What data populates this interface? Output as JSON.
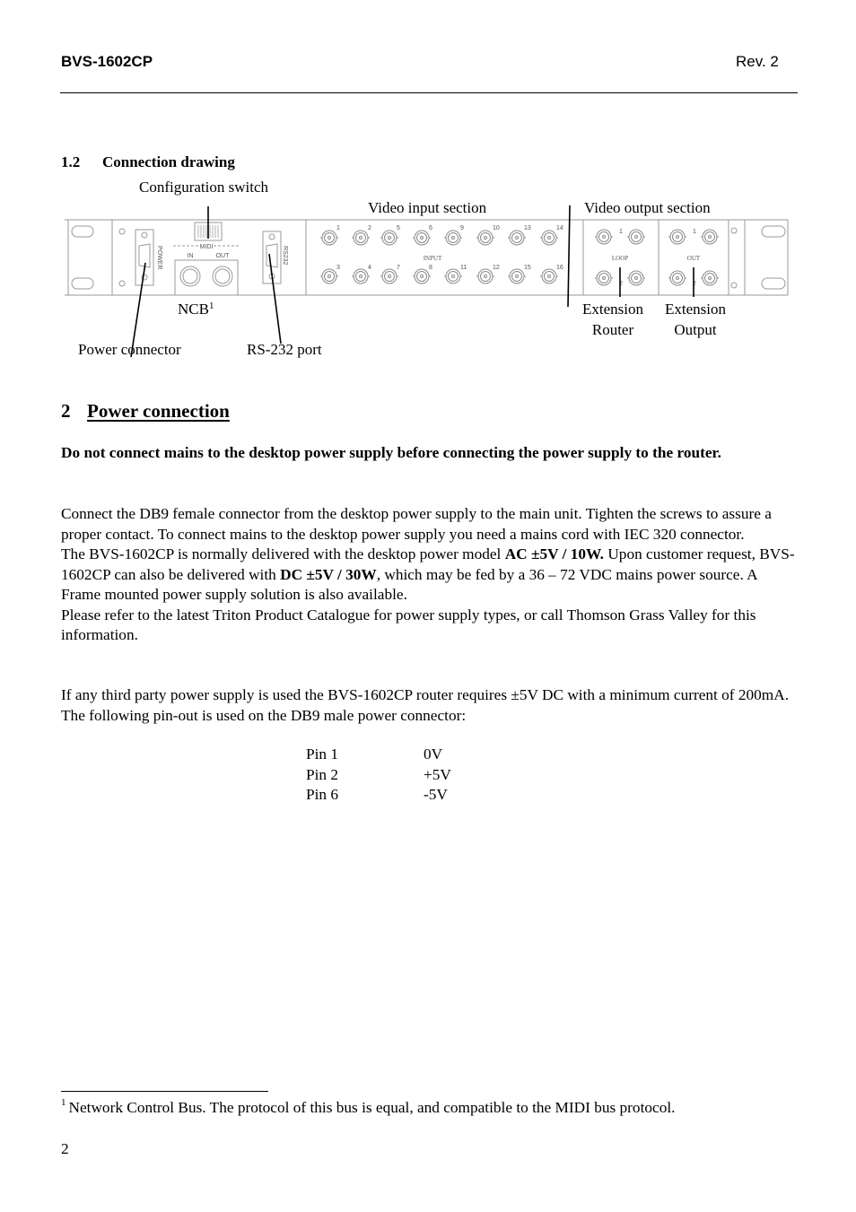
{
  "header": {
    "product": "BVS-1602CP",
    "revision": "Rev. 2"
  },
  "section_1_2": {
    "number": "1.2",
    "title": "Connection drawing"
  },
  "diagram": {
    "callouts": {
      "configuration_switch": "Configuration switch",
      "video_input_section": "Video input section",
      "video_output_section": "Video output section",
      "ncb": "NCB",
      "ncb_footnote_ref": "1",
      "power_connector": "Power connector",
      "rs232_port": "RS-232 port",
      "extension_router_line1": "Extension",
      "extension_router_line2": "Router",
      "extension_output_line1": "Extension",
      "extension_output_line2": "Output"
    },
    "panel_labels": {
      "power": "POWER",
      "midi": "MIDI",
      "midi_in": "IN",
      "midi_out": "OUT",
      "rs232": "RS232",
      "input": "INPUT",
      "loop": "LOOP",
      "out": "OUT"
    },
    "input_top_numbers": [
      "1",
      "2",
      "5",
      "6",
      "9",
      "10",
      "13",
      "14"
    ],
    "input_bottom_numbers": [
      "3",
      "4",
      "7",
      "8",
      "11",
      "12",
      "15",
      "16"
    ],
    "output_top_number": "1",
    "output_bottom_number": "2"
  },
  "section_2": {
    "number": "2",
    "title": "Power connection",
    "warning": "Do not connect mains to the desktop power supply before connecting the power supply to the router.",
    "paragraph1": {
      "s1": "Connect the DB9 female connector from the desktop power supply to the main unit. Tighten the screws to assure a proper contact. To connect mains to the desktop power supply you need a mains cord with IEC 320 connector.",
      "s2a": "The BVS-1602CP is normally delivered with the desktop power model ",
      "s2b": "AC ±5V / 10W.",
      "s2c": " Upon customer request, BVS-1602CP can also be delivered with ",
      "s2d": "DC ±5V / 30W",
      "s2e": ", which may be fed by a 36 – 72 VDC mains power source. A Frame mounted power supply solution is also available.",
      "s3": "Please refer to the latest Triton Product Catalogue for power supply types, or call Thomson Grass Valley for this information."
    },
    "paragraph2": "If any third party power supply is used the BVS-1602CP router requires ±5V DC with a minimum current of 200mA. The following pin-out is used on the DB9 male power connector:",
    "pinout": [
      {
        "pin": "Pin 1",
        "value": "0V"
      },
      {
        "pin": "Pin 2",
        "value": "+5V"
      },
      {
        "pin": "Pin 6",
        "value": "-5V"
      }
    ]
  },
  "footnote": {
    "marker": "1",
    "text": "Network Control Bus. The protocol of this bus is equal, and compatible to the MIDI bus protocol."
  },
  "page_number": "2"
}
